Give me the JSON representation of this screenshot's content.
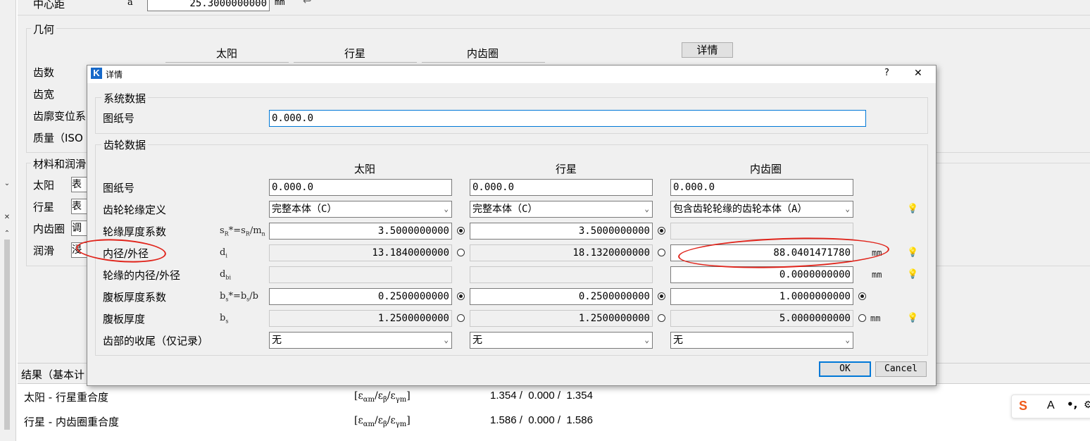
{
  "background": {
    "center_distance": {
      "label": "中心距",
      "symbol": "a",
      "value": "25.3000000000",
      "unit": "mm"
    },
    "geometry": {
      "title": "几何",
      "col_sun": "太阳",
      "col_planet": "行星",
      "col_ring": "内齿圈",
      "details_button": "详情",
      "rows": [
        "齿数",
        "齿宽",
        "齿廓变位系",
        "质量（ISO"
      ]
    },
    "materials": {
      "title": "材料和润滑",
      "rows": [
        {
          "label": "太阳",
          "value": "表"
        },
        {
          "label": "行星",
          "value": "表"
        },
        {
          "label": "内齿圈",
          "value": "调"
        },
        {
          "label": "润滑",
          "value": "浸"
        }
      ]
    },
    "results": {
      "header": "结果（基本计",
      "rows": [
        {
          "label": "太阳 - 行星重合度",
          "values": "1.354 /  0.000 /  1.354"
        },
        {
          "label": "行星 - 内齿圈重合度",
          "values": "1.586 /  0.000 /  1.586"
        }
      ],
      "symbol_main": "ε",
      "sub_alpha": "αm",
      "sub_beta": "β",
      "sub_gamma": "γm"
    }
  },
  "dialog": {
    "title": "详情",
    "logo_letter": "K",
    "help": "?",
    "close": "✕",
    "system_data": {
      "title": "系统数据",
      "drawing_label": "图纸号",
      "drawing_value": "0.000.0"
    },
    "gear_data": {
      "title": "齿轮数据",
      "columns": [
        "太阳",
        "行星",
        "内齿圈"
      ],
      "rows": {
        "drawing": {
          "label": "图纸号",
          "values": [
            "0.000.0",
            "0.000.0",
            "0.000.0"
          ]
        },
        "rim_def": {
          "label": "齿轮轮缘定义",
          "values": [
            "完整本体（C）",
            "完整本体（C）",
            "包含齿轮轮缘的齿轮本体（A）"
          ]
        },
        "rim_factor": {
          "label": "轮缘厚度系数",
          "symbol": "sR*=sR/mn",
          "values": [
            "3.5000000000",
            "3.5000000000",
            ""
          ]
        },
        "diameter": {
          "label": "内径/外径",
          "symbol": "di",
          "values": [
            "13.1840000000",
            "18.1320000000",
            "88.0401471780"
          ],
          "unit": "mm"
        },
        "rim_diameter": {
          "label": "轮缘的内径/外径",
          "symbol": "dbi",
          "values": [
            "",
            "",
            "0.0000000000"
          ],
          "unit": "mm"
        },
        "web_factor": {
          "label": "腹板厚度系数",
          "symbol": "bs*=bs/b",
          "values": [
            "0.2500000000",
            "0.2500000000",
            "1.0000000000"
          ]
        },
        "web_thickness": {
          "label": "腹板厚度",
          "symbol": "bs",
          "values": [
            "1.2500000000",
            "1.2500000000",
            "5.0000000000"
          ],
          "unit": "mm"
        },
        "tooth_tail": {
          "label": "齿部的收尾（仅记录）",
          "values": [
            "无",
            "无",
            "无"
          ]
        }
      }
    },
    "ok": "OK",
    "cancel": "Cancel"
  },
  "ime": {
    "logo": "S",
    "mode": "A",
    "punct": "•,"
  },
  "colors": {
    "annotation": "#e0241b",
    "focus": "#0078d7",
    "logo": "#1769c9"
  }
}
